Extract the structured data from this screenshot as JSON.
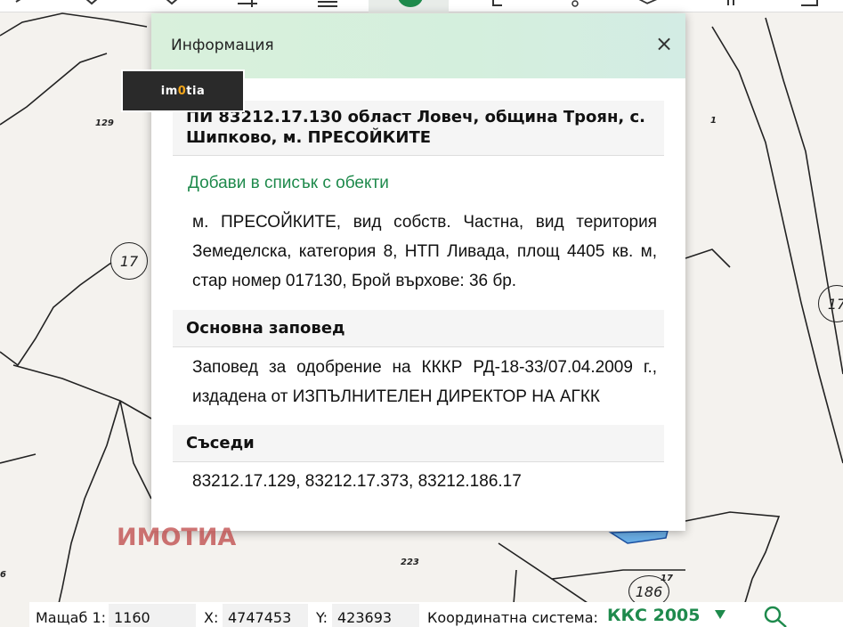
{
  "map": {
    "plot_labels": [
      "129",
      "1",
      "223",
      "17",
      "6"
    ],
    "circle_labels": [
      "17",
      "17",
      "186"
    ]
  },
  "logo": {
    "text_pre": "im",
    "text_accent": "0",
    "text_post": "tia"
  },
  "dialog": {
    "title": "Информация",
    "close_label": "×",
    "parcel_heading": "ПИ 83212.17.130 област Ловеч, община Троян, с. Шипково, м. ПРЕСОЙКИТЕ",
    "add_link": "Добави в списък с обекти",
    "description": "м. ПРЕСОЙКИТЕ, вид собств. Частна, вид територия Земеделска, категория 8, НТП Ливада, площ 4405 кв. м, стар номер 017130, Брой върхове: 36 бр.",
    "order_heading": "Основна заповед",
    "order_text": "Заповед за одобрение на КККР РД-18-33/07.04.2009 г., издадена от ИЗПЪЛНИТЕЛЕН ДИРЕКТОР НА АГКК",
    "neighbors_heading": "Съседи",
    "neighbors_text": "83212.17.129, 83212.17.373, 83212.186.17"
  },
  "watermark": "ИМОТИА",
  "statusbar": {
    "scale_label": "Мащаб 1:",
    "scale_value": "1160",
    "x_label": "X:",
    "x_value": "4747453",
    "y_label": "Y:",
    "y_value": "423693",
    "crs_label": "Координатна система:",
    "crs_value": "ККС 2005"
  },
  "colors": {
    "accent": "#1e8a4c",
    "header_bg": "#d9f0dc",
    "watermark": "#be4646"
  }
}
